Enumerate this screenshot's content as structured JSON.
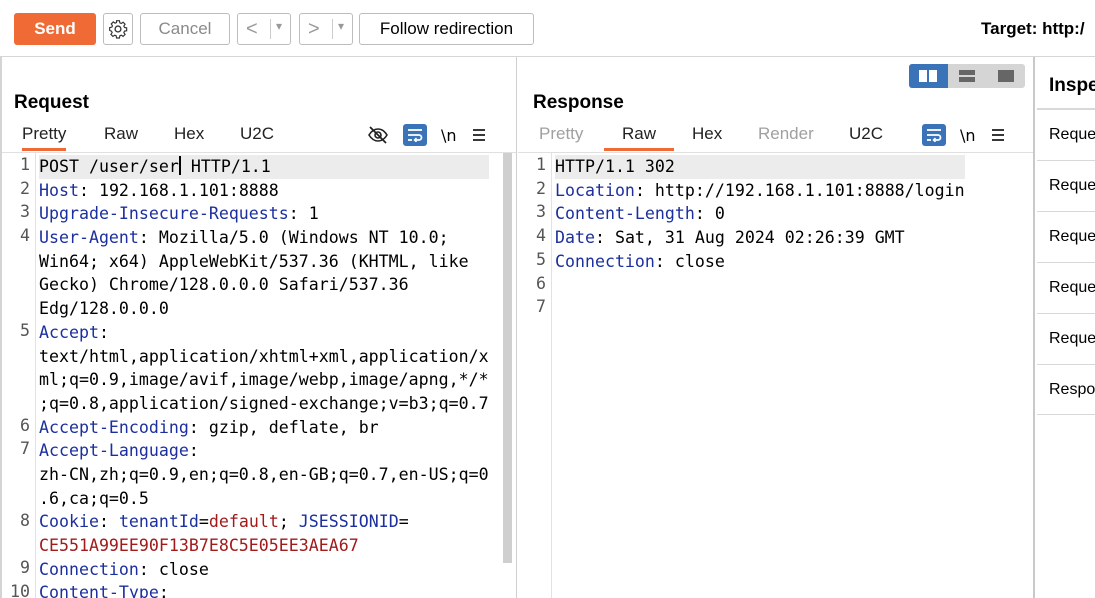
{
  "toolbar": {
    "send_label": "Send",
    "cancel_label": "Cancel",
    "back_glyph": "<",
    "forward_glyph": ">",
    "dropdown_glyph": "▾",
    "follow_redirection_label": "Follow redirection",
    "target_label": "Target: http:/"
  },
  "request": {
    "title": "Request",
    "tabs": [
      "Pretty",
      "Raw",
      "Hex",
      "U2C"
    ],
    "active_tab": "Pretty",
    "newline_tool": "\\n",
    "line_numbers": [
      "1",
      "2",
      "3",
      "4",
      "",
      "",
      "",
      "5",
      "",
      "",
      "",
      "6",
      "7",
      "",
      "",
      "8",
      "",
      "9",
      "10"
    ],
    "lines": [
      {
        "parts": [
          {
            "t": "POST /user/ser",
            "c": "v"
          },
          {
            "caret": true
          },
          {
            "t": " HTTP/1.1",
            "c": "v"
          }
        ],
        "hl": true
      },
      {
        "parts": [
          {
            "t": "Host",
            "c": "k"
          },
          {
            "t": ": 192.168.1.101:8888",
            "c": "v"
          }
        ]
      },
      {
        "parts": [
          {
            "t": "Upgrade-Insecure-Requests",
            "c": "k"
          },
          {
            "t": ": 1",
            "c": "v"
          }
        ]
      },
      {
        "parts": [
          {
            "t": "User-Agent",
            "c": "k"
          },
          {
            "t": ": Mozilla/5.0 (Windows NT 10.0;",
            "c": "v"
          }
        ]
      },
      {
        "parts": [
          {
            "t": "Win64; x64) AppleWebKit/537.36 (KHTML, like",
            "c": "v"
          }
        ]
      },
      {
        "parts": [
          {
            "t": "Gecko) Chrome/128.0.0.0 Safari/537.36",
            "c": "v"
          }
        ]
      },
      {
        "parts": [
          {
            "t": "Edg/128.0.0.0",
            "c": "v"
          }
        ]
      },
      {
        "parts": [
          {
            "t": "Accept",
            "c": "k"
          },
          {
            "t": ":",
            "c": "v"
          }
        ]
      },
      {
        "parts": [
          {
            "t": "text/html,application/xhtml+xml,application/x",
            "c": "v"
          }
        ]
      },
      {
        "parts": [
          {
            "t": "ml;q=0.9,image/avif,image/webp,image/apng,*/*",
            "c": "v"
          }
        ]
      },
      {
        "parts": [
          {
            "t": ";q=0.8,application/signed-exchange;v=b3;q=0.7",
            "c": "v"
          }
        ]
      },
      {
        "parts": [
          {
            "t": "Accept-Encoding",
            "c": "k"
          },
          {
            "t": ": gzip, deflate, br",
            "c": "v"
          }
        ]
      },
      {
        "parts": [
          {
            "t": "Accept-Language",
            "c": "k"
          },
          {
            "t": ":",
            "c": "v"
          }
        ]
      },
      {
        "parts": [
          {
            "t": "zh-CN,zh;q=0.9,en;q=0.8,en-GB;q=0.7,en-US;q=0",
            "c": "v"
          }
        ]
      },
      {
        "parts": [
          {
            "t": ".6,ca;q=0.5",
            "c": "v"
          }
        ]
      },
      {
        "parts": [
          {
            "t": "Cookie",
            "c": "k"
          },
          {
            "t": ": ",
            "c": "v"
          },
          {
            "t": "tenantId",
            "c": "ck"
          },
          {
            "t": "=",
            "c": "v"
          },
          {
            "t": "default",
            "c": "cv"
          },
          {
            "t": "; ",
            "c": "v"
          },
          {
            "t": "JSESSIONID",
            "c": "ck"
          },
          {
            "t": "=",
            "c": "v"
          }
        ]
      },
      {
        "parts": [
          {
            "t": "CE551A99EE90F13B7E8C5E05EE3AEA67",
            "c": "cv"
          }
        ]
      },
      {
        "parts": [
          {
            "t": "Connection",
            "c": "k"
          },
          {
            "t": ": close",
            "c": "v"
          }
        ]
      },
      {
        "parts": [
          {
            "t": "Content-Type",
            "c": "k"
          },
          {
            "t": ":",
            "c": "v"
          }
        ]
      }
    ]
  },
  "response": {
    "title": "Response",
    "tabs": [
      "Pretty",
      "Raw",
      "Hex",
      "Render",
      "U2C"
    ],
    "active_tab": "Raw",
    "disabled_tabs": [
      "Pretty",
      "Render"
    ],
    "newline_tool": "\\n",
    "line_numbers": [
      "1",
      "2",
      "3",
      "4",
      "5",
      "6",
      "7"
    ],
    "lines": [
      {
        "parts": [
          {
            "t": "HTTP/1.1 302",
            "c": "v"
          }
        ],
        "hl": true
      },
      {
        "parts": [
          {
            "t": "Location",
            "c": "k"
          },
          {
            "t": ": http://192.168.1.101:8888/login",
            "c": "v"
          }
        ]
      },
      {
        "parts": [
          {
            "t": "Content-Length",
            "c": "k"
          },
          {
            "t": ": 0",
            "c": "v"
          }
        ]
      },
      {
        "parts": [
          {
            "t": "Date",
            "c": "k"
          },
          {
            "t": ": Sat, 31 Aug 2024 02:26:39 GMT",
            "c": "v"
          }
        ]
      },
      {
        "parts": [
          {
            "t": "Connection",
            "c": "k"
          },
          {
            "t": ": close",
            "c": "v"
          }
        ]
      },
      {
        "parts": []
      },
      {
        "parts": []
      }
    ]
  },
  "inspector": {
    "title": "Inspe",
    "items": [
      "Reque",
      "Reque",
      "Reque",
      "Reque",
      "Reque",
      "Respo"
    ]
  },
  "colors": {
    "accent": "#f06a35",
    "selected_blue": "#3a73b8",
    "header_name": "#1b2f9e",
    "cookie_value": "#a21a1a"
  },
  "icons": {
    "settings": "gear-icon",
    "hide_nonprintable": "eye-slash-icon",
    "wrap": "word-wrap-icon",
    "menu": "hamburger-icon",
    "layout": [
      "split-horizontal-icon",
      "split-vertical-icon",
      "single-pane-icon"
    ]
  }
}
